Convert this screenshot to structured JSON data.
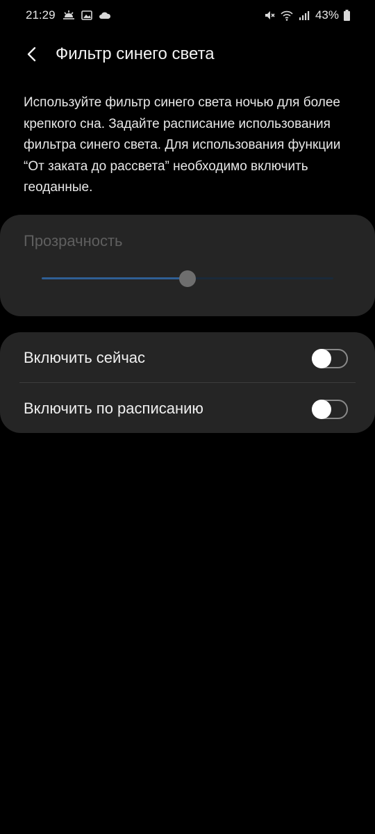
{
  "status_bar": {
    "time": "21:29",
    "left_icons": [
      "weather-sun-icon",
      "image-icon",
      "cloud-icon"
    ],
    "right_icons": [
      "mute-icon",
      "wifi-icon",
      "signal-icon"
    ],
    "battery_text": "43%",
    "battery_icon": "battery-icon"
  },
  "header": {
    "title": "Фильтр синего света",
    "back_icon": "back-arrow-icon"
  },
  "description": "Используйте фильтр синего света ночью для более крепкого сна. Задайте расписание использования фильтра синего света. Для использования функции “От заката до рассвета” необходимо включить геоданные.",
  "opacity": {
    "label": "Прозрачность",
    "value": 0.5,
    "enabled": false
  },
  "toggles": [
    {
      "label": "Включить сейчас",
      "on": false
    },
    {
      "label": "Включить по расписанию",
      "on": false
    }
  ],
  "colors": {
    "background": "#000000",
    "card": "#252525",
    "slider_fill": "#2f5f95",
    "disabled_text": "#5f5f5f"
  }
}
